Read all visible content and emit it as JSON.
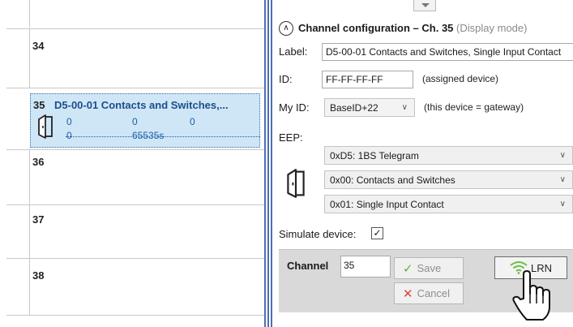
{
  "channels_list": {
    "rows": [
      {
        "num": "34"
      },
      {
        "num": "36"
      },
      {
        "num": "37"
      },
      {
        "num": "38"
      }
    ],
    "selected": {
      "num": "35",
      "name": "D5-00-01 Contacts and Switches,...",
      "values_row1": [
        "0",
        "0",
        "0"
      ],
      "values_row2": [
        "0",
        "65535s"
      ]
    }
  },
  "config": {
    "header_title": "Channel configuration – Ch. 35",
    "header_mode": "(Display mode)",
    "label_caption": "Label:",
    "label_value": "D5-00-01 Contacts and Switches, Single Input Contact",
    "id_caption": "ID:",
    "id_value": "FF-FF-FF-FF",
    "id_hint": "(assigned device)",
    "myid_caption": "My ID:",
    "myid_value": "BaseID+22",
    "myid_hint": "(this device = gateway)",
    "eep_caption": "EEP:",
    "eep_rorg": "0xD5: 1BS Telegram",
    "eep_func": "0x00: Contacts and Switches",
    "eep_type": "0x01: Single Input Contact",
    "simulate_caption": "Simulate device:",
    "simulate_checked": "✓"
  },
  "footer": {
    "channel_caption": "Channel",
    "channel_value": "35",
    "save_label": "Save",
    "cancel_label": "Cancel",
    "lrn_label": "LRN"
  },
  "colors": {
    "selection_bg": "#cfe6f7",
    "selection_text": "#1c4f86",
    "splitter": "#4b6fb4",
    "save_icon": "#5fb336",
    "cancel_icon": "#e0443a",
    "lrn_icon": "#6cc04a"
  },
  "icons": {
    "door": "door-contact-icon",
    "collapse": "chevron-up-circle-icon",
    "save": "checkmark-icon",
    "cancel": "x-icon",
    "lrn": "wifi-icon",
    "cursor": "hand-pointer-icon"
  }
}
